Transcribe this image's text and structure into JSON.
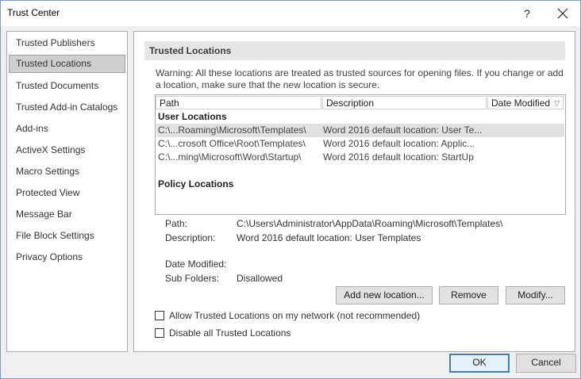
{
  "window": {
    "title": "Trust Center",
    "help_glyph": "?",
    "close_glyph": "✕"
  },
  "sidebar": {
    "items": [
      {
        "label": "Trusted Publishers"
      },
      {
        "label": "Trusted Locations",
        "selected": true
      },
      {
        "label": "Trusted Documents"
      },
      {
        "label": "Trusted Add-in Catalogs"
      },
      {
        "label": "Add-ins"
      },
      {
        "label": "ActiveX Settings"
      },
      {
        "label": "Macro Settings"
      },
      {
        "label": "Protected View"
      },
      {
        "label": "Message Bar"
      },
      {
        "label": "File Block Settings"
      },
      {
        "label": "Privacy Options"
      }
    ]
  },
  "main": {
    "section_title": "Trusted Locations",
    "warning_line1": "Warning: All these locations are treated as trusted sources for opening files.  If you change or add",
    "warning_line2": "a location, make sure that the new location is secure.",
    "table": {
      "columns": [
        "Path",
        "Description",
        "Date Modified"
      ],
      "sort_glyph": "▽",
      "user_group": "User Locations",
      "rows": [
        {
          "path": "C:\\...Roaming\\Microsoft\\Templates\\",
          "description": "Word 2016 default location: User Te..."
        },
        {
          "path": "C:\\...crosoft Office\\Root\\Templates\\",
          "description": "Word 2016 default location: Applic..."
        },
        {
          "path": "C:\\...ming\\Microsoft\\Word\\Startup\\",
          "description": "Word 2016 default location: StartUp"
        }
      ],
      "policy_group": "Policy Locations"
    },
    "details": {
      "path_label": "Path:",
      "path_value": "C:\\Users\\Administrator\\AppData\\Roaming\\Microsoft\\Templates\\",
      "description_label": "Description:",
      "description_value": "Word 2016 default location: User Templates",
      "date_label": "Date Modified:",
      "date_value": "",
      "subfolders_label": "Sub Folders:",
      "subfolders_value": "Disallowed"
    },
    "buttons": {
      "add": "Add new location...",
      "remove": "Remove",
      "modify": "Modify..."
    },
    "checkboxes": {
      "allow_network": {
        "label": "Allow Trusted Locations on my network (not recommended)",
        "checked": false
      },
      "disable_all": {
        "label": "Disable all Trusted Locations",
        "checked": false
      }
    }
  },
  "footer": {
    "ok": "OK",
    "cancel": "Cancel"
  }
}
